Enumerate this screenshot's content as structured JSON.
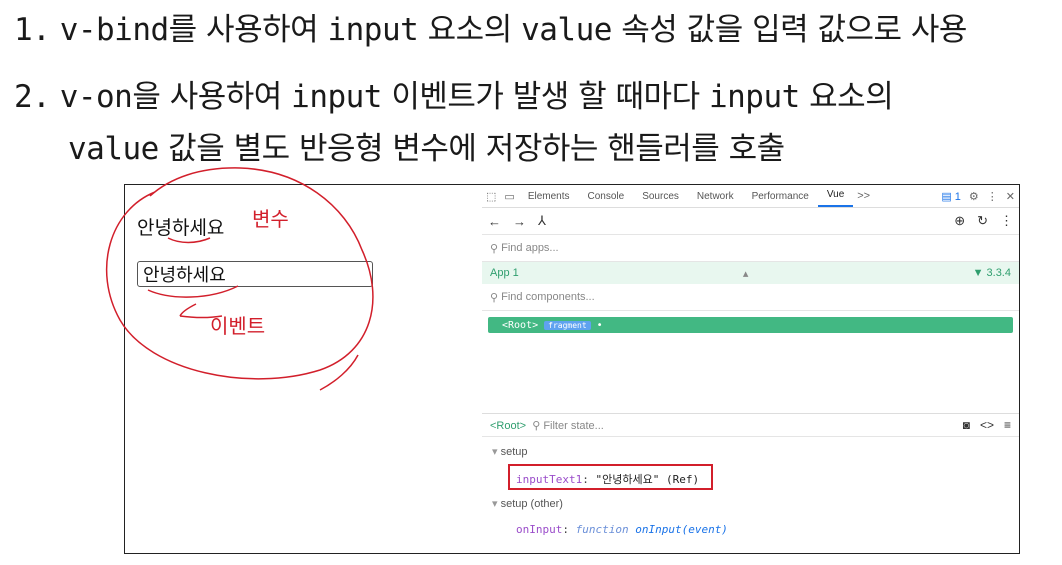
{
  "notes": {
    "n1_num": "1.",
    "n1_code1": "v-bind",
    "n1_t1": "를 사용하여 ",
    "n1_code2": "input",
    "n1_t2": " 요소의 ",
    "n1_code3": "value",
    "n1_t3": " 속성 값을 입력 값으로 사용",
    "n2_num": "2.",
    "n2_code1": "v-on",
    "n2_t1": "을 사용하여 ",
    "n2_code2": "input",
    "n2_t2": " 이벤트가 발생 할 때마다 ",
    "n2_code3": "input",
    "n2_t3": " 요소의",
    "n2b_code1": "value",
    "n2b_t1": " 값을 별도 반응형 변수에 저장하는 핸들러를 호출"
  },
  "app": {
    "text": "안녕하세요",
    "input_value": "안녕하세요"
  },
  "annotations": {
    "var_label": "변수",
    "event_label": "이벤트"
  },
  "devtools": {
    "tabs": [
      "Elements",
      "Console",
      "Sources",
      "Network",
      "Performance",
      "Vue"
    ],
    "more": ">>",
    "badge": "1",
    "find_apps": "Find apps...",
    "app_name": "App 1",
    "vue_version": "3.3.4",
    "find_components": "Find components...",
    "root": "<Root>",
    "fragment": "fragment",
    "state_crumb": "<Root>",
    "filter_state": "Filter state...",
    "section_setup": "setup",
    "state_key": "inputText1",
    "state_value": "\"안녕하세요\" (Ref)",
    "section_setup_other": "setup (other)",
    "fn_key": "onInput",
    "fn_type": "function",
    "fn_sig": "onInput(event)"
  },
  "colors": {
    "vue_green": "#42b883",
    "annotation_red": "#d21f2b"
  }
}
